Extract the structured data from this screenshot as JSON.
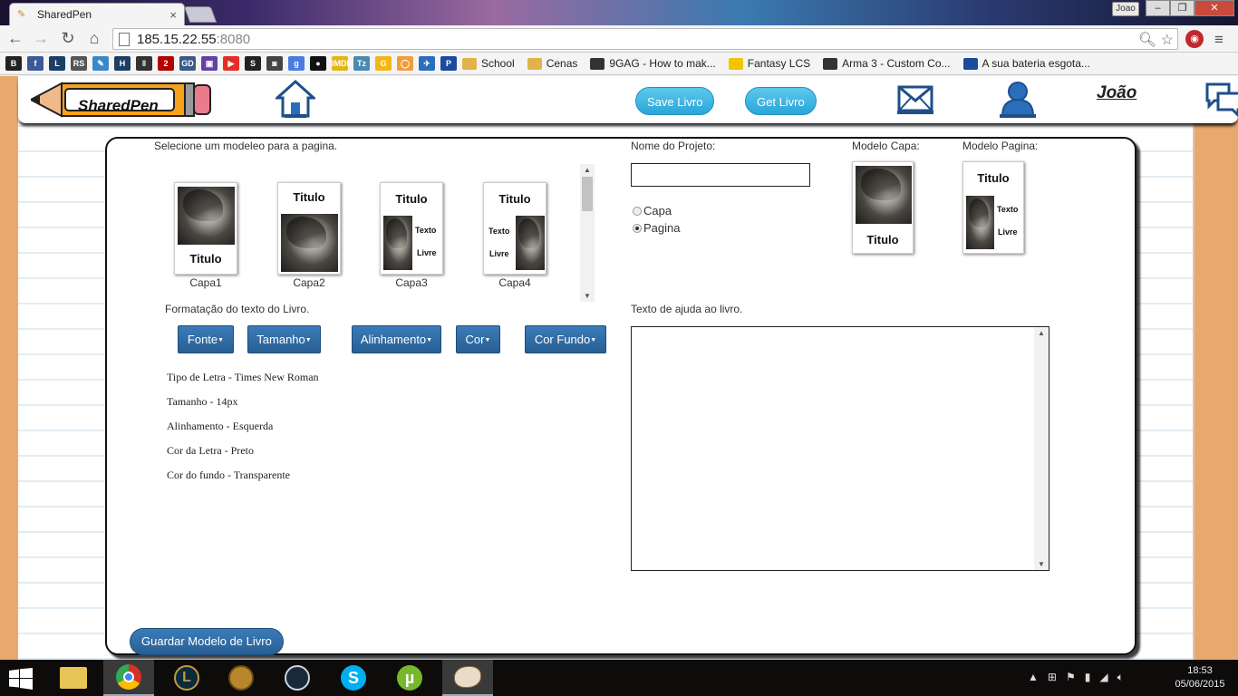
{
  "browser": {
    "tab_title": "SharedPen",
    "tab_close": "×",
    "profile_label": "Joao",
    "minimize": "–",
    "restore": "❐",
    "close": "✕",
    "nav": {
      "back": "←",
      "forward": "→",
      "reload": "↻",
      "home": "⌂"
    },
    "url_host": "185.15.22.55",
    "url_port": ":8080",
    "bookmarks": [
      {
        "icon": "blogger-icon",
        "color": "#222222",
        "glyph": "B"
      },
      {
        "icon": "facebook-icon",
        "color": "#3b5998",
        "glyph": "f"
      },
      {
        "icon": "lol-icon",
        "color": "#1d3e64",
        "glyph": "L"
      },
      {
        "icon": "rs-icon",
        "color": "#555555",
        "glyph": "RS"
      },
      {
        "icon": "edit-icon",
        "color": "#3a88c8",
        "glyph": "✎"
      },
      {
        "icon": "hltv-icon",
        "color": "#1d3e64",
        "glyph": "H"
      },
      {
        "icon": "bar-icon",
        "color": "#333333",
        "glyph": "‖"
      },
      {
        "icon": "number-2-icon",
        "color": "#b30000",
        "glyph": "2"
      },
      {
        "icon": "gd-icon",
        "color": "#3a5a8a",
        "glyph": "GD"
      },
      {
        "icon": "twitch-icon",
        "color": "#6441a5",
        "glyph": "▣"
      },
      {
        "icon": "youtube-icon",
        "color": "#e52d27",
        "glyph": "▶"
      },
      {
        "icon": "s-icon",
        "color": "#222222",
        "glyph": "S"
      },
      {
        "icon": "car-icon",
        "color": "#444444",
        "glyph": "◙"
      },
      {
        "icon": "google-icon",
        "color": "#4a7de0",
        "glyph": "g"
      },
      {
        "icon": "circle-icon",
        "color": "#111111",
        "glyph": "●"
      },
      {
        "icon": "imdb-icon",
        "color": "#e2b616",
        "glyph": "IMDb"
      },
      {
        "icon": "tz-icon",
        "color": "#4a8ab0",
        "glyph": "Tz"
      },
      {
        "icon": "g-orange-icon",
        "color": "#f3b51a",
        "glyph": "G"
      },
      {
        "icon": "chat-bubble-icon",
        "color": "#f39c3a",
        "glyph": "◯"
      },
      {
        "icon": "bird-icon",
        "color": "#2a6ebb",
        "glyph": "✈"
      },
      {
        "icon": "p-icon",
        "color": "#1d4b9c",
        "glyph": "P"
      }
    ],
    "bookmark_links": [
      {
        "label": "School",
        "icon": "folder-icon"
      },
      {
        "label": "Cenas",
        "icon": "folder-icon"
      },
      {
        "label": "9GAG - How to mak...",
        "icon": "9gag-icon"
      },
      {
        "label": "Fantasy LCS",
        "icon": "fantasy-icon"
      },
      {
        "label": "Arma 3 - Custom Co...",
        "icon": "biohazard-icon"
      },
      {
        "label": "A sua bateria esgota...",
        "icon": "p-icon"
      }
    ]
  },
  "header": {
    "logo_text": "SharedPen",
    "save_button": "Save Livro",
    "get_button": "Get Livro",
    "username": "João"
  },
  "models": {
    "select_label": "Selecione um modeleo para a pagina.",
    "items": [
      {
        "name": "Capa1",
        "title": "Titulo"
      },
      {
        "name": "Capa2",
        "title": "Titulo"
      },
      {
        "name": "Capa3",
        "title": "Titulo",
        "text": "Texto",
        "text2": "Livre"
      },
      {
        "name": "Capa4",
        "title": "Titulo",
        "text": "Texto",
        "text2": "Livre"
      }
    ]
  },
  "project": {
    "name_label": "Nome do Projeto:",
    "name_value": "",
    "radio_capa": "Capa",
    "radio_pagina": "Pagina",
    "selected": "Pagina"
  },
  "preview": {
    "capa_label": "Modelo Capa:",
    "capa_title": "Titulo",
    "pagina_label": "Modelo Pagina:",
    "pagina_title": "Titulo",
    "pagina_text": "Texto",
    "pagina_text2": "Livre"
  },
  "formatting": {
    "label": "Formatação do texto do Livro.",
    "buttons": [
      "Fonte",
      "Tamanho",
      "Alinhamento",
      "Cor",
      "Cor Fundo"
    ],
    "lines": [
      "Tipo de Letra - Times New Roman",
      "Tamanho - 14px",
      "Alinhamento - Esquerda",
      "Cor da Letra - Preto",
      "Cor do fundo - Transparente"
    ]
  },
  "help": {
    "label": "Texto de ajuda ao livro.",
    "value": ""
  },
  "actions": {
    "save_model": "Guardar Modelo de Livro"
  },
  "taskbar": {
    "time": "18:53",
    "date": "05/06/2015",
    "apps": [
      "file-explorer-icon",
      "chrome-icon",
      "league-of-legends-icon",
      "hearthstone-icon",
      "steam-icon",
      "skype-icon",
      "utorrent-icon",
      "paint-icon"
    ]
  }
}
